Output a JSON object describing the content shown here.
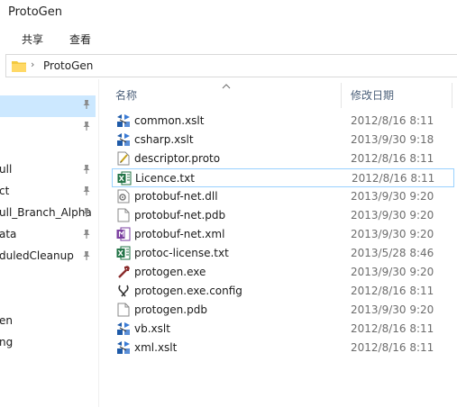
{
  "window": {
    "title": "ProtoGen"
  },
  "ribbon": {
    "tabs": [
      {
        "label": "共享"
      },
      {
        "label": "查看"
      }
    ]
  },
  "address": {
    "path": "ProtoGen"
  },
  "nav": {
    "items": [
      {
        "label": "",
        "pinned": true
      },
      {
        "label": "",
        "pinned": true
      },
      {
        "label": "ull",
        "pinned": true
      },
      {
        "label": "ct",
        "pinned": true
      },
      {
        "label": "ull_Branch_Alpha",
        "pinned": true
      },
      {
        "label": "ata",
        "pinned": true
      },
      {
        "label": "duledCleanup",
        "pinned": true
      },
      {
        "label": "",
        "pinned": false
      },
      {
        "label": "en",
        "pinned": false
      },
      {
        "label": "ng",
        "pinned": false
      }
    ]
  },
  "columns": {
    "name": "名称",
    "date_modified": "修改日期"
  },
  "files": [
    {
      "name": "common.xslt",
      "date": "2012/8/16 8:11",
      "icon": "xslt-icon"
    },
    {
      "name": "csharp.xslt",
      "date": "2013/9/30 9:18",
      "icon": "xslt-icon"
    },
    {
      "name": "descriptor.proto",
      "date": "2012/8/16 8:11",
      "icon": "proto-file-icon"
    },
    {
      "name": "Licence.txt",
      "date": "2012/8/16 8:11",
      "icon": "excel-icon",
      "selected": true
    },
    {
      "name": "protobuf-net.dll",
      "date": "2013/9/30 9:20",
      "icon": "dll-icon"
    },
    {
      "name": "protobuf-net.pdb",
      "date": "2013/9/30 9:20",
      "icon": "file-icon"
    },
    {
      "name": "protobuf-net.xml",
      "date": "2013/9/30 9:20",
      "icon": "xml-icon"
    },
    {
      "name": "protoc-license.txt",
      "date": "2013/5/28 8:46",
      "icon": "excel-icon"
    },
    {
      "name": "protogen.exe",
      "date": "2013/9/30 9:20",
      "icon": "exe-icon"
    },
    {
      "name": "protogen.exe.config",
      "date": "2012/8/16 8:11",
      "icon": "config-icon"
    },
    {
      "name": "protogen.pdb",
      "date": "2013/9/30 9:20",
      "icon": "file-icon"
    },
    {
      "name": "vb.xslt",
      "date": "2012/8/16 8:11",
      "icon": "xslt-icon"
    },
    {
      "name": "xml.xslt",
      "date": "2012/8/16 8:11",
      "icon": "xslt-icon"
    }
  ]
}
